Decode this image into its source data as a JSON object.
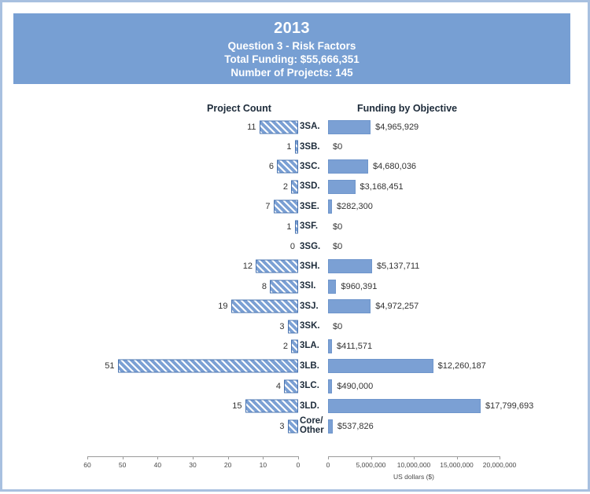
{
  "header": {
    "year": "2013",
    "question": "Question 3 - Risk Factors",
    "total_funding": "Total Funding: $55,666,351",
    "number_of_projects": "Number of Projects: 145"
  },
  "columns": {
    "left_header": "Project Count",
    "right_header": "Funding by Objective"
  },
  "axis": {
    "left_ticks": [
      "60",
      "50",
      "40",
      "30",
      "20",
      "10",
      "0"
    ],
    "left_values": [
      60,
      50,
      40,
      30,
      20,
      10,
      0
    ],
    "right_ticks": [
      "0",
      "5,000,000",
      "10,000,000",
      "15,000,000",
      "20,000,000"
    ],
    "right_values": [
      0,
      5000000,
      10000000,
      15000000,
      20000000
    ],
    "right_title": "US dollars ($)"
  },
  "colors": {
    "header_blue": "#779fd3",
    "bar_blue": "#7ba0d4",
    "border_blue": "#a8c0e0",
    "hatch_line": "#4a74b0",
    "text_dark": "#1d2b3a"
  },
  "chart_data": {
    "type": "bar",
    "title": "2013 — Question 3 - Risk Factors",
    "orientation": "horizontal-bidirectional",
    "categories": [
      "3SA.",
      "3SB.",
      "3SC.",
      "3SD.",
      "3SE.",
      "3SF.",
      "3SG.",
      "3SH.",
      "3SI.",
      "3SJ.",
      "3SK.",
      "3LA.",
      "3LB.",
      "3LC.",
      "3LD.",
      "Core/\nOther"
    ],
    "series": [
      {
        "name": "Project Count",
        "direction": "left",
        "xlabel": "Project Count",
        "xlim": [
          0,
          60
        ],
        "values": [
          11,
          1,
          6,
          2,
          7,
          1,
          0,
          12,
          8,
          19,
          3,
          2,
          51,
          4,
          15,
          3
        ],
        "labels": [
          "11",
          "1",
          "6",
          "2",
          "7",
          "1",
          "0",
          "12",
          "8",
          "19",
          "3",
          "2",
          "51",
          "4",
          "15",
          "3"
        ]
      },
      {
        "name": "Funding by Objective",
        "direction": "right",
        "xlabel": "US dollars ($)",
        "xlim": [
          0,
          20000000
        ],
        "values": [
          4965929,
          0,
          4680036,
          3168451,
          282300,
          0,
          0,
          5137711,
          960391,
          4972257,
          0,
          411571,
          12260187,
          490000,
          17799693,
          537826
        ],
        "labels": [
          "$4,965,929",
          "$0",
          "$4,680,036",
          "$3,168,451",
          "$282,300",
          "$0",
          "$0",
          "$5,137,711",
          "$960,391",
          "$4,972,257",
          "$0",
          "$411,571",
          "$12,260,187",
          "$490,000",
          "$17,799,693",
          "$537,826"
        ]
      }
    ],
    "grid": false,
    "legend": "none"
  }
}
